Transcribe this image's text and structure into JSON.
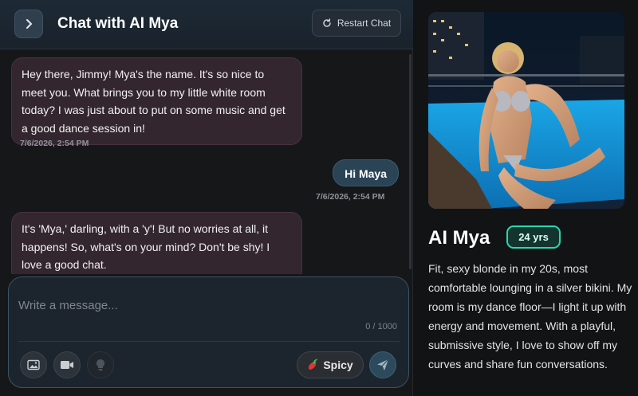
{
  "header": {
    "title": "Chat with AI Mya",
    "restart_label": "Restart Chat",
    "back_icon": "chevron-right-icon",
    "restart_icon": "refresh-icon"
  },
  "messages": [
    {
      "sender": "ai",
      "text": "Hey there, Jimmy! Mya's the name. It's so nice to meet you. What brings you to my little white room today? I was just about to put on some music and get a good dance session in!",
      "timestamp": "7/6/2026, 2:54 PM"
    },
    {
      "sender": "user",
      "text": "Hi Maya",
      "timestamp": "7/6/2026, 2:54 PM"
    },
    {
      "sender": "ai",
      "text": "It's 'Mya,' darling, with a 'y'! But no worries at all, it happens! So, what's on your mind? Don't be shy! I love a good chat."
    }
  ],
  "composer": {
    "placeholder": "Write a message...",
    "counter": "0 / 1000",
    "spicy_label": "Spicy",
    "buttons": [
      "image-icon",
      "video-icon",
      "lightbulb-icon",
      "pepper-icon",
      "send-icon"
    ]
  },
  "profile": {
    "name": "AI Mya",
    "age": "24 yrs",
    "bio": "Fit, sexy blonde in my 20s, most comfortable lounging in a silver bikini. My room is my dance floor—I light it up with energy and movement. With a playful, submissive style, I love to show off my curves and share fun conversations."
  },
  "colors": {
    "accent_teal": "#2ad7b0",
    "ai_bubble": "#33262f",
    "user_bubble": "#2a4456",
    "header_bg": "#1d2a36"
  }
}
